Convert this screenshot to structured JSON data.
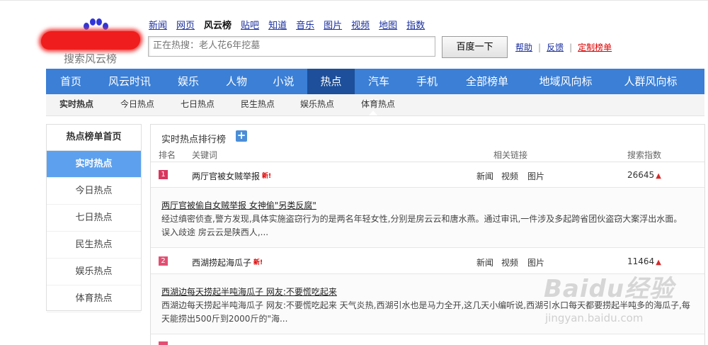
{
  "logo": {
    "text": "搜索风云榜"
  },
  "topnav": [
    {
      "label": "新闻",
      "current": false
    },
    {
      "label": "网页",
      "current": false
    },
    {
      "label": "风云榜",
      "current": true
    },
    {
      "label": "贴吧",
      "current": false
    },
    {
      "label": "知道",
      "current": false
    },
    {
      "label": "音乐",
      "current": false
    },
    {
      "label": "图片",
      "current": false
    },
    {
      "label": "视频",
      "current": false
    },
    {
      "label": "地图",
      "current": false
    },
    {
      "label": "指数",
      "current": false
    }
  ],
  "search": {
    "placeholder": "正在热搜：老人花6年挖墓",
    "button": "百度一下"
  },
  "links": {
    "help": "帮助",
    "feedback": "反馈",
    "custom": "定制榜单"
  },
  "mainnav": [
    "首页",
    "风云时讯",
    "娱乐",
    "人物",
    "小说",
    "热点",
    "汽车",
    "手机",
    "全部榜单",
    "地域风向标",
    "人群风向标"
  ],
  "subnav": [
    "实时热点",
    "今日热点",
    "七日热点",
    "民生热点",
    "娱乐热点",
    "体育热点"
  ],
  "sidebar": {
    "header": "热点榜单首页",
    "items": [
      "实时热点",
      "今日热点",
      "七日热点",
      "民生热点",
      "娱乐热点",
      "体育热点"
    ]
  },
  "panel": {
    "title": "实时热点排行榜",
    "headers": {
      "rank": "排名",
      "keyword": "关键词",
      "links": "相关链接",
      "index": "搜索指数"
    },
    "rows": [
      {
        "rank": "1",
        "keyword": "两厅官被女贼举报",
        "new_tag": "新!",
        "links": [
          "新闻",
          "视频",
          "图片"
        ],
        "index": "26645",
        "detail_title": "两厅官被偷自女贼举报 女神偷\"另类反腐\"",
        "detail_text": "经过缜密侦查,警方发现,具体实施盗窃行为的是两名年轻女性,分别是房云云和唐水燕。通过审讯,一件涉及多起跨省团伙盗窃大案浮出水面。 误入歧途 房云云是陕西人,..."
      },
      {
        "rank": "2",
        "keyword": "西湖捞起海瓜子",
        "new_tag": "新!",
        "links": [
          "新闻",
          "视频",
          "图片"
        ],
        "index": "11464",
        "detail_title": "西湖边每天捞起半吨海瓜子 网友:不要慌吃起来",
        "detail_text": "西湖边每天捞起半吨海瓜子 网友:不要慌吃起来 天气炎热,西湖引水也是马力全开,这几天小编听说,西湖引水口每天都要捞起半吨多的海瓜子,每天能捞出500斤到2000斤的\"海..."
      }
    ]
  },
  "watermark": {
    "brand": "Baidu经验",
    "url": "jingyan.baidu.com"
  },
  "colors": {
    "nav_bg": "#3b7fd6",
    "nav_active": "#1d4f9a",
    "side_active": "#5da1ee",
    "rank1": "#d8365d",
    "rank2": "#e24f73",
    "up_arrow": "#d62b2b"
  }
}
